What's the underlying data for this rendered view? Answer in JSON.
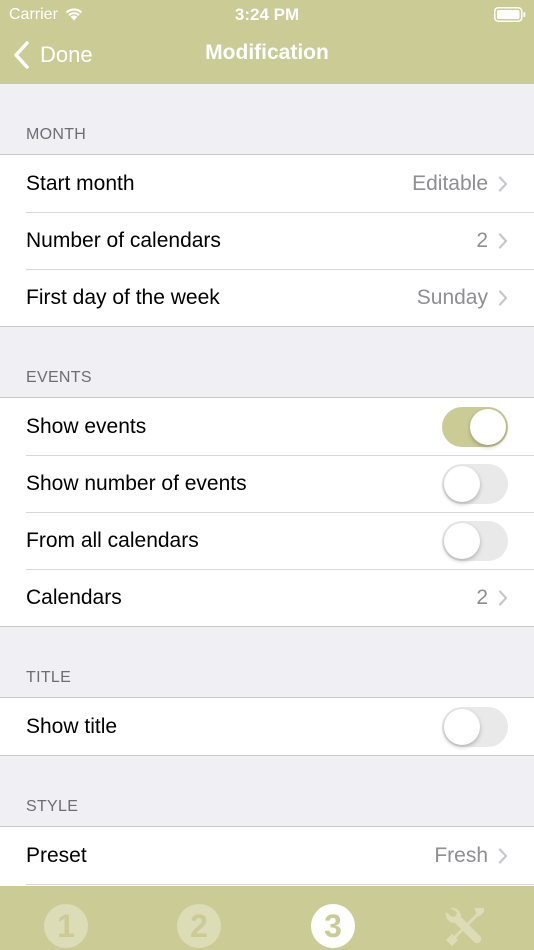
{
  "status": {
    "carrier": "Carrier",
    "time": "3:24 PM"
  },
  "nav": {
    "back_label": "Done",
    "title": "Modification"
  },
  "sections": {
    "month": {
      "header": "MONTH",
      "rows": [
        {
          "label": "Start month",
          "value": "Editable"
        },
        {
          "label": "Number of calendars",
          "value": "2"
        },
        {
          "label": "First day of the week",
          "value": "Sunday"
        }
      ]
    },
    "events": {
      "header": "EVENTS",
      "show_events": {
        "label": "Show events",
        "on": true
      },
      "show_number": {
        "label": "Show number of events",
        "on": false
      },
      "all_calendars": {
        "label": "From all calendars",
        "on": false
      },
      "calendars": {
        "label": "Calendars",
        "value": "2"
      }
    },
    "title": {
      "header": "TITLE",
      "show_title": {
        "label": "Show title",
        "on": false
      }
    },
    "style": {
      "header": "STYLE",
      "preset": {
        "label": "Preset",
        "value": "Fresh"
      }
    }
  },
  "tabs": [
    {
      "label": "1",
      "icon": "number-1-icon"
    },
    {
      "label": "2",
      "icon": "number-2-icon"
    },
    {
      "label": "3",
      "icon": "number-3-icon"
    },
    {
      "label": "",
      "icon": "tools-icon"
    }
  ],
  "colors": {
    "accent": "#cbcb96",
    "background": "#efeff4"
  }
}
